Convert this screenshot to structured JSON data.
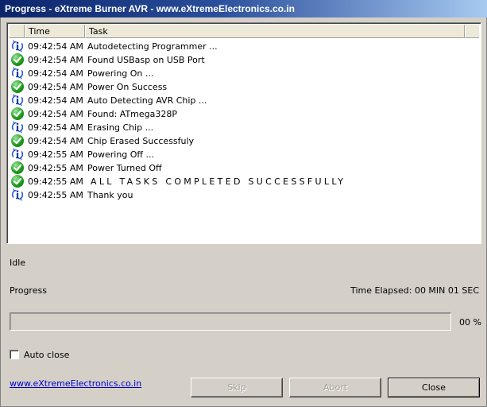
{
  "window": {
    "title": "Progress - eXtreme Burner AVR - www.eXtremeElectronics.co.in"
  },
  "list": {
    "columns": {
      "time": "Time",
      "task": "Task"
    },
    "rows": [
      {
        "icon": "info-icon",
        "time": "09:42:54 AM",
        "task": "Autodetecting Programmer ..."
      },
      {
        "icon": "check-icon",
        "time": "09:42:54 AM",
        "task": "Found USBasp on USB Port"
      },
      {
        "icon": "info-icon",
        "time": "09:42:54 AM",
        "task": "Powering On ..."
      },
      {
        "icon": "check-icon",
        "time": "09:42:54 AM",
        "task": "Power On Success"
      },
      {
        "icon": "info-icon",
        "time": "09:42:54 AM",
        "task": "Auto Detecting AVR Chip ..."
      },
      {
        "icon": "check-icon",
        "time": "09:42:54 AM",
        "task": "Found: ATmega328P"
      },
      {
        "icon": "info-icon",
        "time": "09:42:54 AM",
        "task": "Erasing Chip ..."
      },
      {
        "icon": "check-icon",
        "time": "09:42:54 AM",
        "task": "Chip Erased Successfuly"
      },
      {
        "icon": "info-icon",
        "time": "09:42:55 AM",
        "task": "Powering Off ..."
      },
      {
        "icon": "check-icon",
        "time": "09:42:55 AM",
        "task": "Power Turned Off"
      },
      {
        "icon": "check-icon",
        "time": "09:42:55 AM",
        "task": "ALL TASKS COMPLETED SUCCESSFULLY"
      },
      {
        "icon": "info-icon",
        "time": "09:42:55 AM",
        "task": "Thank you"
      }
    ]
  },
  "status": {
    "state": "Idle",
    "progress_label": "Progress",
    "time_elapsed": "Time Elapsed: 00 MIN  01 SEC",
    "progress_percent": 0,
    "progress_text": "00 %"
  },
  "options": {
    "auto_close_label": "Auto close",
    "auto_close_checked": false
  },
  "footer": {
    "link_text": "www.eXtremeElectronics.co.in",
    "skip_label": "Skip",
    "abort_label": "Abort",
    "close_label": "Close"
  },
  "colors": {
    "title_start": "#0a246a",
    "title_end": "#a6caf0",
    "link": "#0000cc",
    "success": "#1e9e1e",
    "info": "#2a5bd7"
  }
}
